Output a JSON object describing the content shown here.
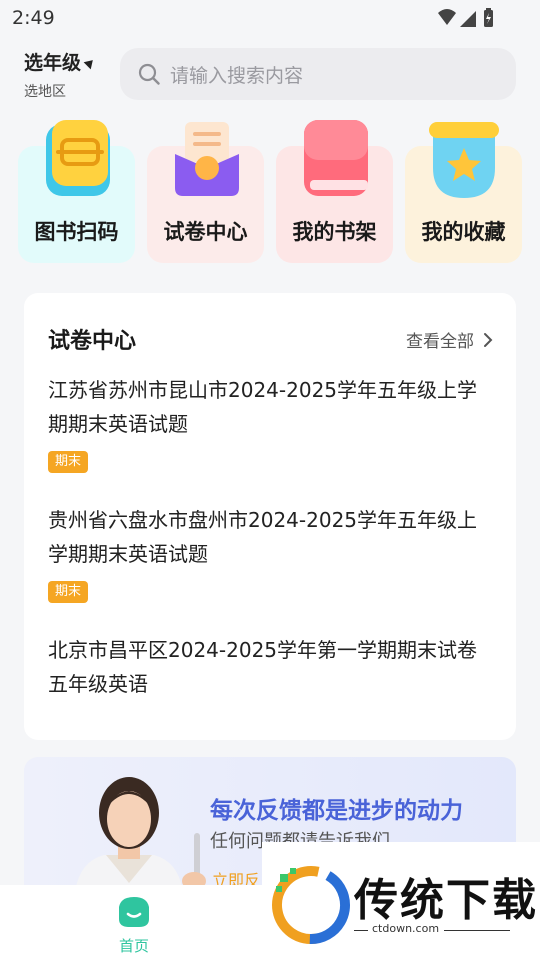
{
  "status_bar": {
    "time": "2:49"
  },
  "grade_selector": {
    "label": "选年级",
    "region": "选地区"
  },
  "search": {
    "placeholder": "请输入搜索内容"
  },
  "quick_actions": [
    {
      "label": "图书扫码",
      "bg": "#e2fbfb"
    },
    {
      "label": "试卷中心",
      "bg": "#fcebea"
    },
    {
      "label": "我的书架",
      "bg": "#fde6e6"
    },
    {
      "label": "我的收藏",
      "bg": "#fdf2dc"
    }
  ],
  "paper_section": {
    "title": "试卷中心",
    "more": "查看全部",
    "items": [
      {
        "title": "江苏省苏州市昆山市2024-2025学年五年级上学期期末英语试题",
        "tag": "期末"
      },
      {
        "title": "贵州省六盘水市盘州市2024-2025学年五年级上学期期末英语试题",
        "tag": "期末"
      },
      {
        "title": "北京市昌平区2024-2025学年第一学期期末试卷五年级英语",
        "tag": ""
      }
    ]
  },
  "banner": {
    "title": "每次反馈都是进步的动力",
    "subtitle": "任何问题都请告诉我们",
    "button": "立即反"
  },
  "tab_bar": {
    "home_label": "首页"
  },
  "watermark": {
    "brand": "传统下载",
    "url": "ctdown.com"
  },
  "colors": {
    "accent": "#2fc59f",
    "tag": "#f5a623",
    "banner_title": "#4a63d8"
  }
}
